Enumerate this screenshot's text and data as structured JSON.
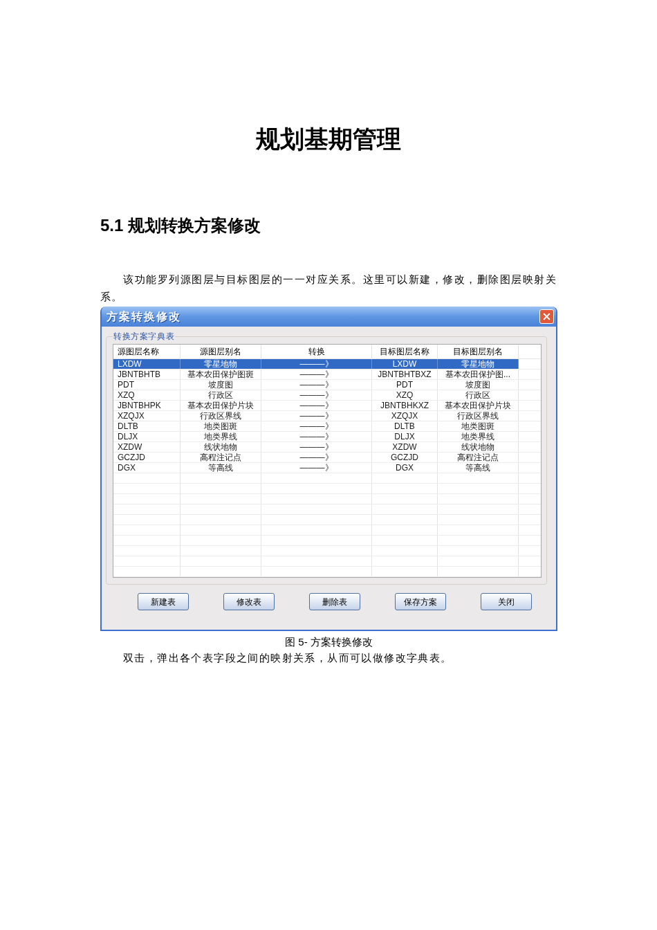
{
  "title": "规划基期管理",
  "section_heading": "5.1 规划转换方案修改",
  "intro_paragraph": "该功能罗列源图层与目标图层的一一对应关系。这里可以新建，修改，删除图层映射关系。",
  "dialog": {
    "title": "方案转换修改",
    "group_label": "转换方案字典表",
    "table": {
      "columns": [
        "源图层名称",
        "源图层别名",
        "转换",
        "目标图层名称",
        "目标图层别名"
      ],
      "rows": [
        {
          "cells": [
            "LXDW",
            "零星地物",
            "———》",
            "LXDW",
            "零星地物"
          ],
          "selected": true
        },
        {
          "cells": [
            "JBNTBHTB",
            "基本农田保护图斑",
            "———》",
            "JBNTBHTBXZ",
            "基本农田保护图..."
          ],
          "selected": false
        },
        {
          "cells": [
            "PDT",
            "坡度图",
            "———》",
            "PDT",
            "坡度图"
          ],
          "selected": false
        },
        {
          "cells": [
            "XZQ",
            "行政区",
            "———》",
            "XZQ",
            "行政区"
          ],
          "selected": false
        },
        {
          "cells": [
            "JBNTBHPK",
            "基本农田保护片块",
            "———》",
            "JBNTBHKXZ",
            "基本农田保护片块"
          ],
          "selected": false
        },
        {
          "cells": [
            "XZQJX",
            "行政区界线",
            "———》",
            "XZQJX",
            "行政区界线"
          ],
          "selected": false
        },
        {
          "cells": [
            "DLTB",
            "地类图斑",
            "———》",
            "DLTB",
            "地类图斑"
          ],
          "selected": false
        },
        {
          "cells": [
            "DLJX",
            "地类界线",
            "———》",
            "DLJX",
            "地类界线"
          ],
          "selected": false
        },
        {
          "cells": [
            "XZDW",
            "线状地物",
            "———》",
            "XZDW",
            "线状地物"
          ],
          "selected": false
        },
        {
          "cells": [
            "GCZJD",
            "高程注记点",
            "———》",
            "GCZJD",
            "高程注记点"
          ],
          "selected": false
        },
        {
          "cells": [
            "DGX",
            "等高线",
            "———》",
            "DGX",
            "等高线"
          ],
          "selected": false
        }
      ]
    },
    "buttons": [
      "新建表",
      "修改表",
      "删除表",
      "保存方案",
      "关闭"
    ]
  },
  "figure_caption": "图 5- 方案转换修改",
  "body_paragraph": "双击，弹出各个表字段之间的映射关系，从而可以做修改字典表。"
}
